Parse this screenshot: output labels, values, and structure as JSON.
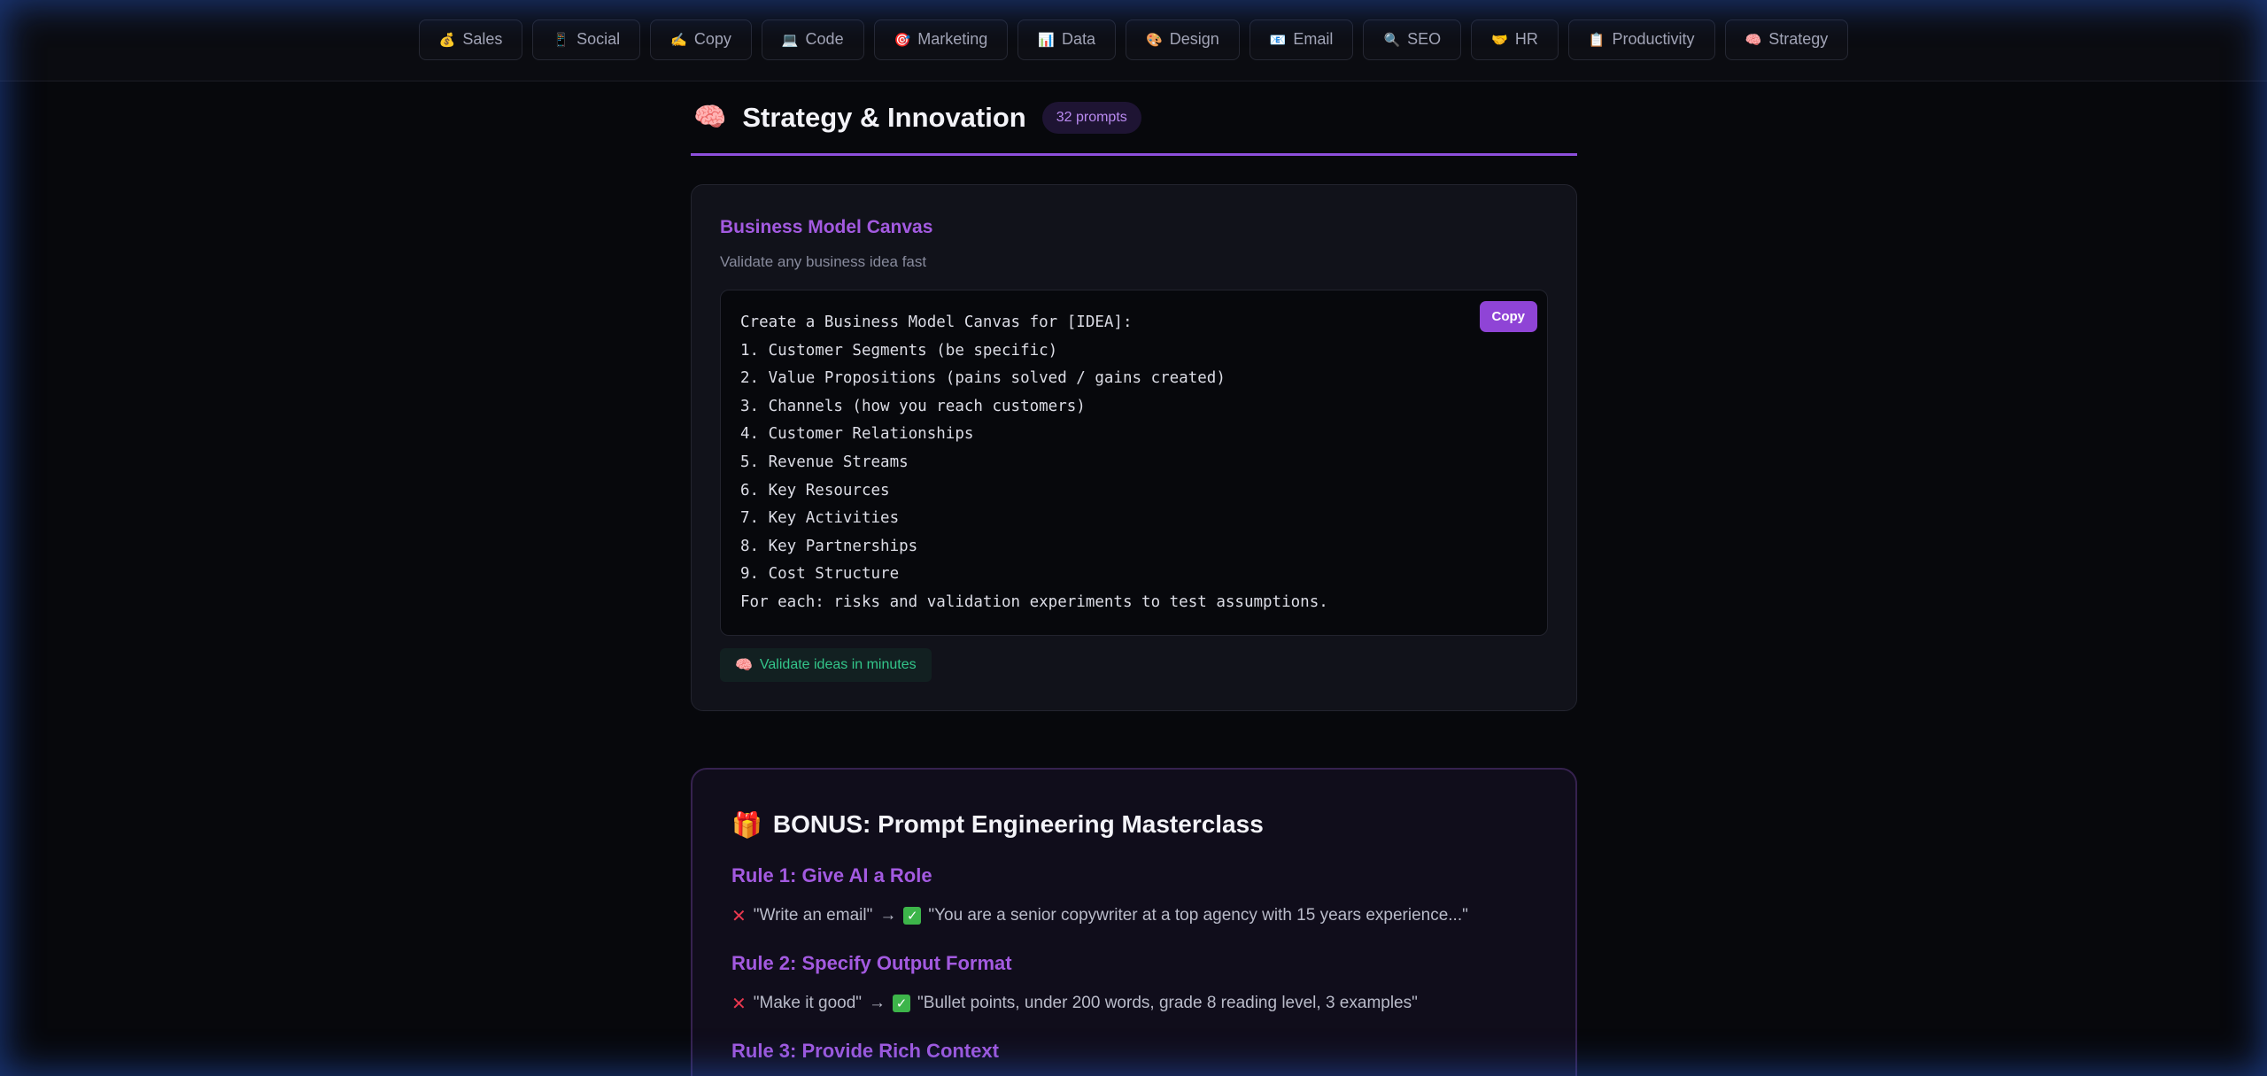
{
  "nav": [
    {
      "icon": "💰",
      "label": "Sales"
    },
    {
      "icon": "📱",
      "label": "Social"
    },
    {
      "icon": "✍️",
      "label": "Copy"
    },
    {
      "icon": "💻",
      "label": "Code"
    },
    {
      "icon": "🎯",
      "label": "Marketing"
    },
    {
      "icon": "📊",
      "label": "Data"
    },
    {
      "icon": "🎨",
      "label": "Design"
    },
    {
      "icon": "📧",
      "label": "Email"
    },
    {
      "icon": "🔍",
      "label": "SEO"
    },
    {
      "icon": "🤝",
      "label": "HR"
    },
    {
      "icon": "📋",
      "label": "Productivity"
    },
    {
      "icon": "🧠",
      "label": "Strategy"
    }
  ],
  "section": {
    "icon": "🧠",
    "title": "Strategy & Innovation",
    "count": "32 prompts"
  },
  "card": {
    "title": "Business Model Canvas",
    "subtitle": "Validate any business idea fast",
    "copy_label": "Copy",
    "lines": [
      "Create a Business Model Canvas for [IDEA]:",
      "1. Customer Segments (be specific)",
      "2. Value Propositions (pains solved / gains created)",
      "3. Channels (how you reach customers)",
      "4. Customer Relationships",
      "5. Revenue Streams",
      "6. Key Resources",
      "7. Key Activities",
      "8. Key Partnerships",
      "9. Cost Structure",
      "For each: risks and validation experiments to test assumptions."
    ],
    "tag_icon": "🧠",
    "tag": "Validate ideas in minutes"
  },
  "bonus": {
    "icon": "🎁",
    "title": "BONUS: Prompt Engineering Masterclass",
    "rules": [
      {
        "title": "Rule 1: Give AI a Role",
        "bad": "\"Write an email\"",
        "arrow": "→",
        "good": "\"You are a senior copywriter at a top agency with 15 years experience...\""
      },
      {
        "title": "Rule 2: Specify Output Format",
        "bad": "\"Make it good\"",
        "arrow": "→",
        "good": "\"Bullet points, under 200 words, grade 8 reading level, 3 examples\""
      },
      {
        "title": "Rule 3: Provide Rich Context"
      }
    ]
  },
  "colors": {
    "accent": "#8f44d6",
    "accent_text": "#a35ae0",
    "tag_green": "#33c58a",
    "background": "#07080c"
  }
}
